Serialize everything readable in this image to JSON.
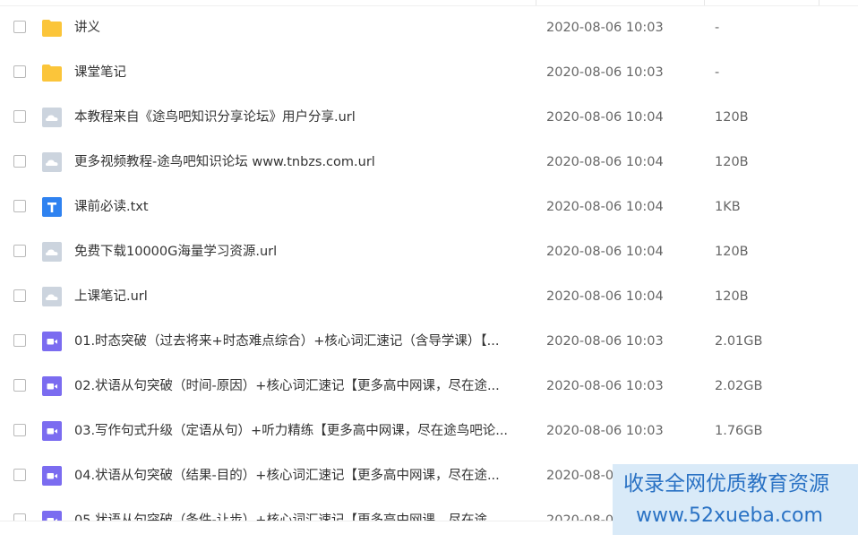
{
  "files": [
    {
      "icon": "folder",
      "name": "讲义",
      "modified": "2020-08-06 10:03",
      "size": "-"
    },
    {
      "icon": "folder",
      "name": "课堂笔记",
      "modified": "2020-08-06 10:03",
      "size": "-"
    },
    {
      "icon": "url",
      "name": "本教程来自《途鸟吧知识分享论坛》用户分享.url",
      "modified": "2020-08-06 10:04",
      "size": "120B"
    },
    {
      "icon": "url",
      "name": "更多视频教程-途鸟吧知识论坛 www.tnbzs.com.url",
      "modified": "2020-08-06 10:04",
      "size": "120B"
    },
    {
      "icon": "txt",
      "name": "课前必读.txt",
      "modified": "2020-08-06 10:04",
      "size": "1KB"
    },
    {
      "icon": "url",
      "name": "免费下载10000G海量学习资源.url",
      "modified": "2020-08-06 10:04",
      "size": "120B"
    },
    {
      "icon": "url",
      "name": "上课笔记.url",
      "modified": "2020-08-06 10:04",
      "size": "120B"
    },
    {
      "icon": "video",
      "name": "01.时态突破（过去将来+时态难点综合）+核心词汇速记（含导学课）【...",
      "modified": "2020-08-06 10:03",
      "size": "2.01GB"
    },
    {
      "icon": "video",
      "name": "02.状语从句突破（时间-原因）+核心词汇速记【更多高中网课，尽在途...",
      "modified": "2020-08-06 10:03",
      "size": "2.02GB"
    },
    {
      "icon": "video",
      "name": "03.写作句式升级（定语从句）+听力精练【更多高中网课，尽在途鸟吧论...",
      "modified": "2020-08-06 10:03",
      "size": "1.76GB"
    },
    {
      "icon": "video",
      "name": "04.状语从句突破（结果-目的）+核心词汇速记【更多高中网课，尽在途...",
      "modified": "2020-08-0",
      "size": ""
    },
    {
      "icon": "video",
      "name": "05.状语从句突破（条件-让步）+核心词汇速记【更多高中网课，尽在途...",
      "modified": "2020-08-0",
      "size": ""
    }
  ],
  "watermark": {
    "line1": "收录全网优质教育资源",
    "line2": "www.52xueba.com"
  },
  "colors": {
    "folder": "#fbc53a",
    "url": "#ccd4de",
    "txt": "#2f82f0",
    "video": "#7b6cf0",
    "watermark_text": "#2a72c4"
  }
}
